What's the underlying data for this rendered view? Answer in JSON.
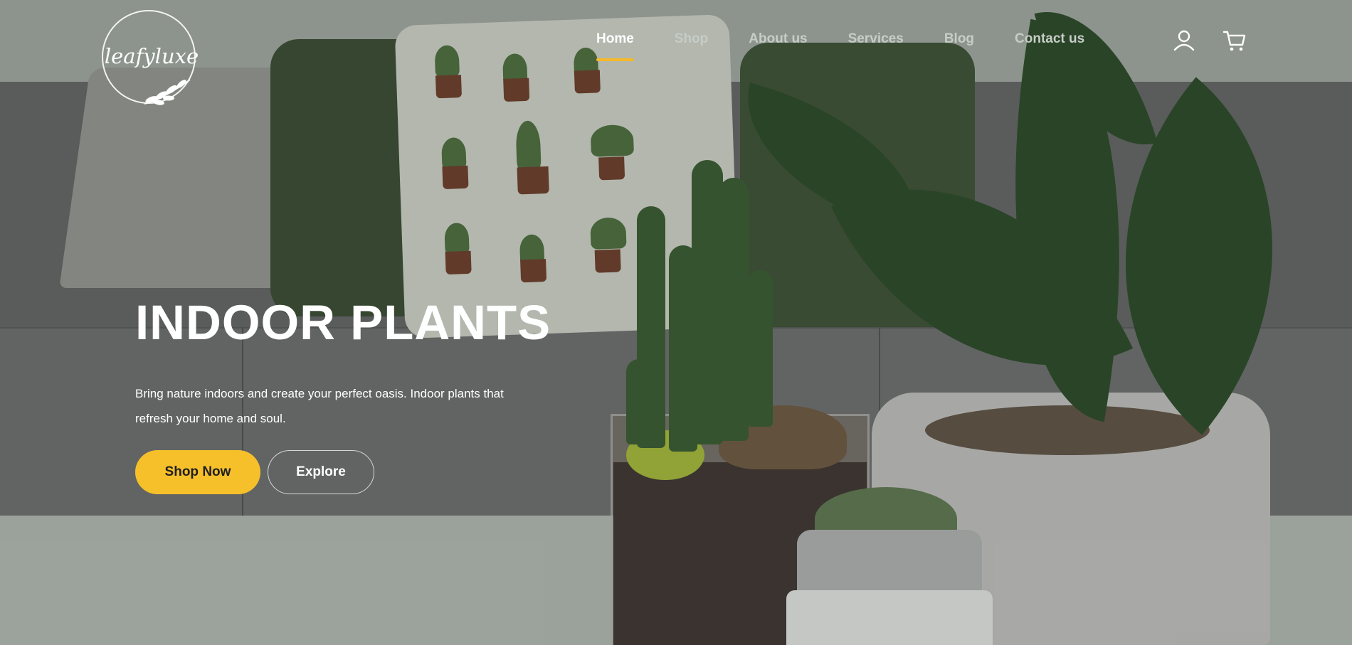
{
  "brand": {
    "logo_text": "leafyluxe",
    "accent_color": "#f6c02b"
  },
  "nav": {
    "items": [
      {
        "label": "Home",
        "active": true
      },
      {
        "label": "Shop",
        "active": false
      },
      {
        "label": "About us",
        "active": false
      },
      {
        "label": "Services",
        "active": false
      },
      {
        "label": "Blog",
        "active": false
      },
      {
        "label": "Contact us",
        "active": false
      }
    ],
    "icons": [
      "user-icon",
      "cart-icon"
    ]
  },
  "hero": {
    "title": "INDOOR PLANTS",
    "description": "Bring nature indoors and create your perfect oasis. Indoor plants that refresh your home and soul.",
    "primary_button": "Shop Now",
    "secondary_button": "Explore"
  }
}
